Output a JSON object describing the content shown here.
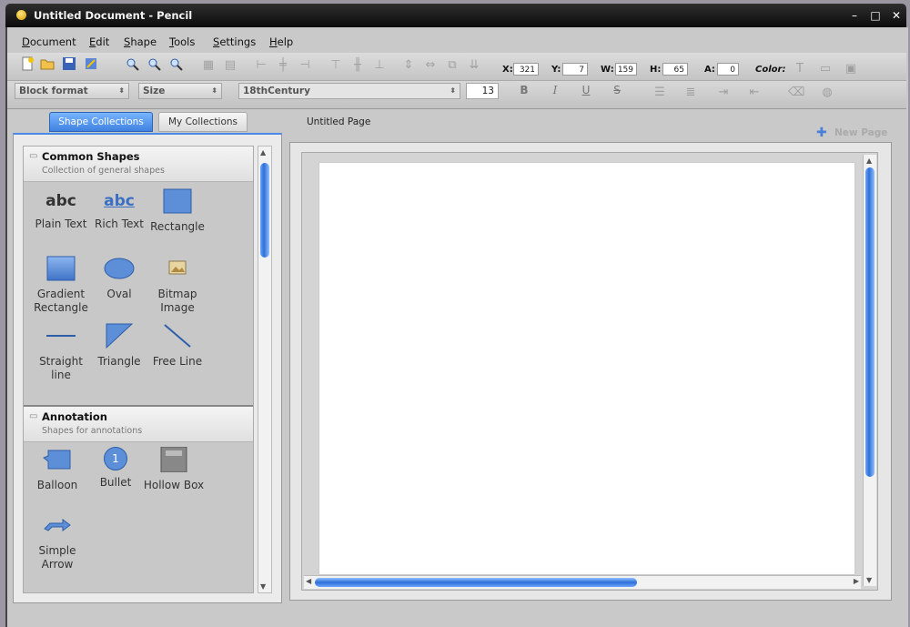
{
  "window": {
    "title": "Untitled Document - Pencil",
    "controls": {
      "minimize": "–",
      "maximize": "□",
      "close": "✕"
    }
  },
  "menu": [
    "Document",
    "Edit",
    "Shape",
    "Tools",
    "Settings",
    "Help"
  ],
  "geometry": {
    "x_label": "X:",
    "x_value": "321",
    "y_label": "Y:",
    "y_value": "7",
    "w_label": "W:",
    "w_value": "159",
    "h_label": "H:",
    "h_value": "65",
    "a_label": "A:",
    "a_value": "0",
    "color_label": "Color:"
  },
  "format": {
    "block_format": "Block format",
    "size": "Size",
    "font": "18thCentury",
    "font_size": "13",
    "bold": "B",
    "italic": "I",
    "underline": "U",
    "strike": "S"
  },
  "sidebar": {
    "tabs": [
      "Shape Collections",
      "My Collections"
    ],
    "groups": [
      {
        "title": "Common Shapes",
        "subtitle": "Collection of general shapes",
        "shapes": [
          "Plain Text",
          "Rich Text",
          "Rectangle",
          "Gradient Rectangle",
          "Oval",
          "Bitmap Image",
          "Straight line",
          "Triangle",
          "Free Line"
        ]
      },
      {
        "title": "Annotation",
        "subtitle": "Shapes for annotations",
        "shapes": [
          "Balloon",
          "Bullet",
          "Hollow Box",
          "Simple Arrow"
        ]
      }
    ],
    "icon_text": {
      "plain_text": "abc",
      "rich_text": "abc",
      "bullet": "1"
    }
  },
  "page": {
    "tab_label": "Untitled Page",
    "new_page_label": "New Page"
  },
  "colors": {
    "accent": "#3f82e0",
    "titlebar": "#1a1a1a",
    "scrollbar": "#2f6fd6"
  }
}
